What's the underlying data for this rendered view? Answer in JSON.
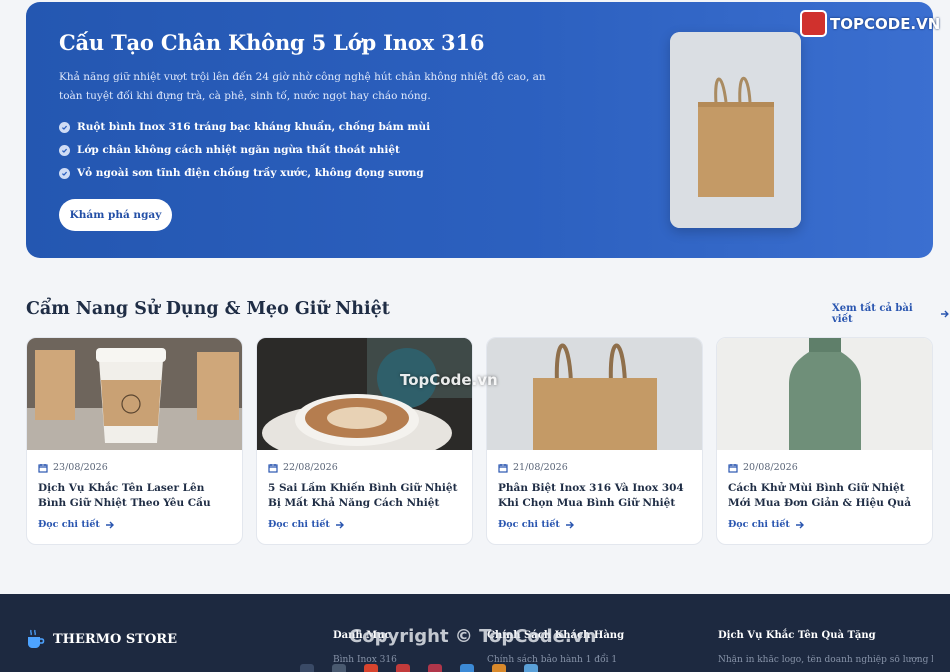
{
  "hero": {
    "title": "Cấu Tạo Chân Không 5 Lớp Inox 316",
    "description": "Khả năng giữ nhiệt vượt trội lên đến 24 giờ nhờ công nghệ hút chân không nhiệt độ cao, an toàn tuyệt đối khi đựng trà, cà phê, sinh tố, nước ngọt hay cháo nóng.",
    "features": [
      "Ruột bình Inox 316 tráng bạc kháng khuẩn, chống bám mùi",
      "Lớp chân không cách nhiệt ngăn ngừa thất thoát nhiệt",
      "Vỏ ngoài sơn tĩnh điện chống trầy xước, không đọng sương"
    ],
    "button_label": "Khám phá ngay"
  },
  "watermark": {
    "logo_text": "TOPCODE.VN",
    "center_text": "TopCode.vn",
    "copyright_text": "Copyright © TopCode.vn"
  },
  "section": {
    "title": "Cẩm Nang Sử Dụng & Mẹo Giữ Nhiệt",
    "see_all_label": "Xem tất cả bài viết"
  },
  "articles": [
    {
      "date": "23/08/2026",
      "title": "Dịch Vụ Khắc Tên Laser Lên Bình Giữ Nhiệt Theo Yêu Cầu",
      "more": "Đọc chi tiết"
    },
    {
      "date": "22/08/2026",
      "title": "5 Sai Lầm Khiến Bình Giữ Nhiệt Bị Mất Khả Năng Cách Nhiệt",
      "more": "Đọc chi tiết"
    },
    {
      "date": "21/08/2026",
      "title": "Phân Biệt Inox 316 Và Inox 304 Khi Chọn Mua Bình Giữ Nhiệt",
      "more": "Đọc chi tiết"
    },
    {
      "date": "20/08/2026",
      "title": "Cách Khử Mùi Bình Giữ Nhiệt Mới Mua Đơn Giản & Hiệu Quả",
      "more": "Đọc chi tiết"
    }
  ],
  "footer": {
    "brand": "THERMO STORE",
    "columns": [
      {
        "title": "Danh Mục",
        "first_item": "Bình Inox 316"
      },
      {
        "title": "Chính Sách Khách Hàng",
        "first_item": "Chính sách bảo hành 1 đổi 1"
      },
      {
        "title": "Dịch Vụ Khắc Tên Quà Tặng",
        "first_item": "Nhận in khắc logo, tên doanh nghiệp số lượng lớn"
      }
    ]
  },
  "colors": {
    "hero_blue": "#2c60bf",
    "accent_link": "#2a56b0",
    "footer_bg": "#1d2940"
  }
}
